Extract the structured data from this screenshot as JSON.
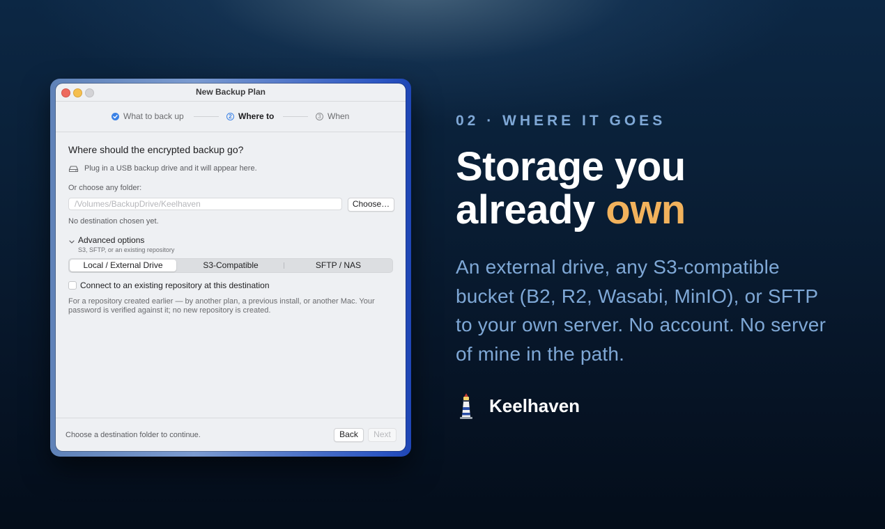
{
  "window": {
    "title": "New Backup Plan",
    "steps": [
      {
        "label": "What to back up",
        "state": "done"
      },
      {
        "label": "Where to",
        "state": "active",
        "number": "2"
      },
      {
        "label": "When",
        "state": "pending",
        "number": "3"
      }
    ],
    "question": "Where should the encrypted backup go?",
    "usb_hint": "Plug in a USB backup drive and it will appear here.",
    "choose_folder_label": "Or choose any folder:",
    "path_placeholder": "/Volumes/BackupDrive/Keelhaven",
    "choose_button": "Choose…",
    "no_destination": "No destination chosen yet.",
    "advanced": {
      "title": "Advanced options",
      "subtitle": "S3, SFTP, or an existing repository"
    },
    "segments": [
      "Local / External Drive",
      "S3-Compatible",
      "SFTP / NAS"
    ],
    "selected_segment": "Local / External Drive",
    "connect_existing_label": "Connect to an existing repository at this destination",
    "connect_existing_checked": false,
    "connect_note": "For a repository created earlier — by another plan, a previous install, or another Mac. Your password is verified against it; no new repository is created.",
    "footer_message": "Choose a destination folder to continue.",
    "back_button": "Back",
    "next_button": "Next",
    "next_enabled": false
  },
  "hero": {
    "eyebrow": "02 · WHERE IT GOES",
    "headline_line1": "Storage you",
    "headline_line2_prefix": "already ",
    "headline_accent": "own",
    "body": "An external drive, any S3-compatible bucket (B2, R2, Wasabi, MinIO), or SFTP to your own server. No account. No server of mine in the path.",
    "brand_name": "Keelhaven",
    "brand_icon": "lighthouse-icon"
  },
  "colors": {
    "accent_blue": "#3b82e6",
    "eyebrow_blue": "#7fa8d6",
    "highlight_orange": "#f2b25c"
  }
}
